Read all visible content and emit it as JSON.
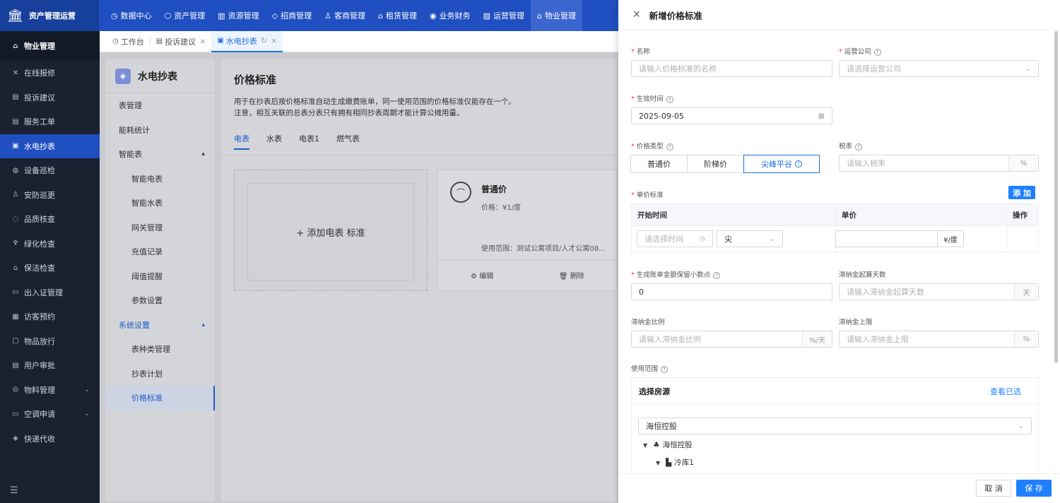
{
  "app": {
    "title": "资产管理运营"
  },
  "topnav": [
    {
      "label": "数据中心",
      "icon": "◷"
    },
    {
      "label": "资产管理",
      "icon": "⬡"
    },
    {
      "label": "资源管理",
      "icon": "▥"
    },
    {
      "label": "招商管理",
      "icon": "◇"
    },
    {
      "label": "客商管理",
      "icon": "♙"
    },
    {
      "label": "租赁管理",
      "icon": "⌂"
    },
    {
      "label": "业务财务",
      "icon": "◉"
    },
    {
      "label": "运营管理",
      "icon": "▨"
    },
    {
      "label": "物业管理",
      "icon": "⌂"
    }
  ],
  "sidebar": {
    "header": "物业管理",
    "items": [
      {
        "label": "在线报修",
        "icon": "✕"
      },
      {
        "label": "投诉建议",
        "icon": "▤"
      },
      {
        "label": "服务工单",
        "icon": "▤"
      },
      {
        "label": "水电抄表",
        "icon": "▣"
      },
      {
        "label": "设备巡检",
        "icon": "◍"
      },
      {
        "label": "安防巡更",
        "icon": "♙"
      },
      {
        "label": "品质核查",
        "icon": "◌"
      },
      {
        "label": "绿化检查",
        "icon": "♆"
      },
      {
        "label": "保洁检查",
        "icon": "⌂"
      },
      {
        "label": "出入证管理",
        "icon": "▭"
      },
      {
        "label": "访客预约",
        "icon": "▦"
      },
      {
        "label": "物品放行",
        "icon": "▢"
      },
      {
        "label": "用户审批",
        "icon": "▤"
      },
      {
        "label": "物料管理",
        "icon": "◎"
      },
      {
        "label": "空调申请",
        "icon": "▭"
      },
      {
        "label": "快递代收",
        "icon": "◈"
      }
    ]
  },
  "tabs": [
    {
      "label": "工作台",
      "icon": "◷"
    },
    {
      "label": "投诉建议",
      "icon": "▤"
    },
    {
      "label": "水电抄表",
      "icon": "▣"
    }
  ],
  "submenu": {
    "title": "水电抄表",
    "items": [
      "表管理",
      "能耗统计"
    ],
    "group1": "智能表",
    "group1_items": [
      "智能电表",
      "智能水表",
      "网关管理",
      "充值记录",
      "阈值提醒",
      "参数设置"
    ],
    "group2": "系统设置",
    "group2_items": [
      "表种类管理",
      "抄表计划",
      "价格标准"
    ]
  },
  "panel": {
    "title": "价格标准",
    "desc1": "用于在抄表后按价格标准自动生成缴费账单，同一使用范围的价格标准仅能存在一个。",
    "desc2": "注意，相互关联的总表分表只有拥有相同抄表周期才能计算公摊用量。",
    "tabs": [
      "电表",
      "水表",
      "电表1",
      "燃气表"
    ],
    "add_card": "+ 添加电表 标准",
    "card": {
      "name": "普通价",
      "price": "价格：¥1/度",
      "scope": "使用范围：测试公寓项目/人才公寓08...",
      "edit": "编辑",
      "delete": "删除"
    }
  },
  "drawer": {
    "title": "新增价格标准",
    "name_label": "名称",
    "name_placeholder": "请输入价格标准的名称",
    "company_label": "运营公司",
    "company_placeholder": "请选择运营公司",
    "effective_label": "生效时间",
    "effective_value": "2025-09-05",
    "price_type_label": "价格类型",
    "price_types": [
      "普通价",
      "阶梯价",
      "尖峰平谷"
    ],
    "tax_label": "税率",
    "tax_placeholder": "请输入税率",
    "tax_suffix": "%",
    "unit_label": "单价标准",
    "add_button": "添 加",
    "col_start": "开始时间",
    "col_price": "单价",
    "col_action": "操作",
    "time_placeholder": "请选择时间",
    "period_value": "尖",
    "price_unit": "¥/度",
    "decimal_label": "生成账单金额保留小数点",
    "decimal_value": "0",
    "late_days_label": "滞纳金起算天数",
    "late_days_placeholder": "请输入滞纳金起算天数",
    "late_days_suffix": "天",
    "late_ratio_label": "滞纳金比例",
    "late_ratio_placeholder": "请输入滞纳金比例",
    "late_ratio_suffix": "%/天",
    "late_cap_label": "滞纳金上限",
    "late_cap_placeholder": "请输入滞纳金上限",
    "late_cap_suffix": "%",
    "scope_label": "使用范围",
    "select_source": "选择房源",
    "view_selected": "查看已选",
    "org_value": "海恒控股",
    "tree_root": "海恒控股",
    "tree_child": "冷库1",
    "cancel": "取 消",
    "save": "保 存"
  }
}
